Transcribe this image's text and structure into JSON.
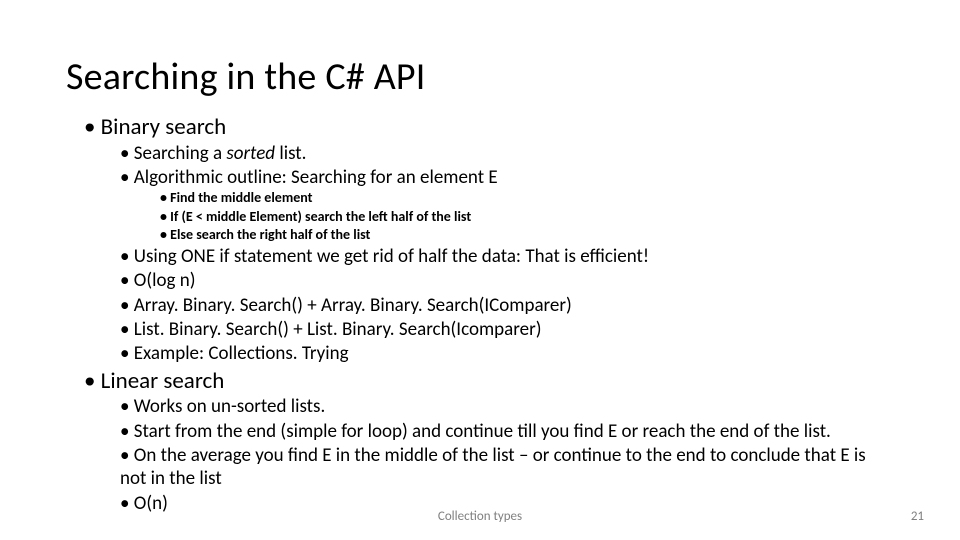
{
  "title": "Searching in the C# API",
  "binary": {
    "heading": "Binary search",
    "sorted_pre": "Searching a ",
    "sorted_em": "sorted",
    "sorted_post": " list.",
    "outline": "Algorithmic outline: Searching for an element E",
    "steps": {
      "a": "Find the middle element",
      "b": "If (E < middle Element) search the left half of the list",
      "c": "Else search the right half of the list"
    },
    "one_if": "Using ONE if statement we get rid of half the data: That is efficient!",
    "bigO": "O(log n)",
    "array": "Array. Binary. Search() + Array. Binary. Search(IComparer)",
    "list": "List. Binary. Search() + List. Binary. Search(Icomparer)",
    "example": "Example: Collections. Trying"
  },
  "linear": {
    "heading": "Linear search",
    "unsorted": "Works on un-sorted lists.",
    "start": "Start from the end (simple for loop) and continue till you find E or reach the end of the list.",
    "avg": "On the average you find E in the middle of the list – or continue to the end to conclude that E is not in the list",
    "bigO": "O(n)"
  },
  "footer": {
    "center": "Collection types",
    "page": "21"
  }
}
